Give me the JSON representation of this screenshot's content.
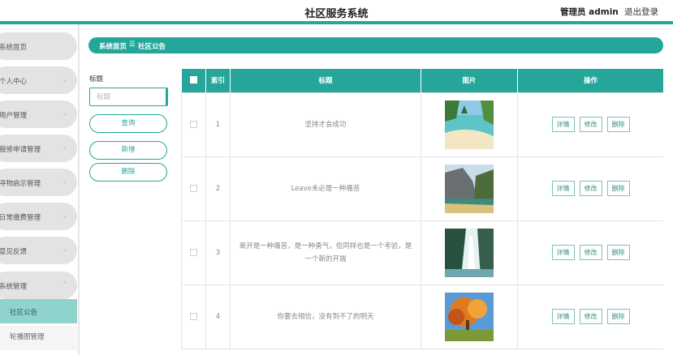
{
  "header": {
    "title": "社区服务系统",
    "admin_label": "管理员 admin",
    "logout_label": "退出登录"
  },
  "sidebar": {
    "items": [
      {
        "label": "系统首页",
        "chevron": ""
      },
      {
        "label": "个人中心",
        "chevron": "⌄"
      },
      {
        "label": "用户管理",
        "chevron": "⌄"
      },
      {
        "label": "报修申请管理",
        "chevron": "⌄"
      },
      {
        "label": "寻物启示管理",
        "chevron": "⌄"
      },
      {
        "label": "日常缴费管理",
        "chevron": "⌄"
      },
      {
        "label": "意见反馈",
        "chevron": "⌄"
      },
      {
        "label": "系统管理",
        "chevron": "⌃"
      }
    ],
    "sub_active": "社区公告",
    "sub_next": "轮播图管理"
  },
  "breadcrumb": {
    "home": "系统首页",
    "separator": "☰",
    "current": "社区公告"
  },
  "search": {
    "label": "标题",
    "placeholder": "标题",
    "value": "",
    "query_button": "查询",
    "add_button": "新增",
    "delete_button": "删除"
  },
  "table": {
    "headers": {
      "index": "索引",
      "title": "标题",
      "image": "图片",
      "actions": "操作"
    },
    "action_labels": {
      "detail": "详情",
      "edit": "修改",
      "delete": "删除"
    },
    "rows": [
      {
        "index": "1",
        "title": "坚持才会成功",
        "image_icon": "beach-photo"
      },
      {
        "index": "2",
        "title": "Leave未必是一种痛苦",
        "image_icon": "cliff-lake-photo"
      },
      {
        "index": "3",
        "title": "离开是一种痛苦，是一种勇气，但同样也是一个考验，是一个新的开端",
        "image_icon": "waterfall-photo"
      },
      {
        "index": "4",
        "title": "你要去相信，没有到不了的明天",
        "image_icon": "autumn-tree-photo"
      }
    ]
  },
  "colors": {
    "accent": "#26a69a",
    "menu_bg": "#e3e3e3",
    "active_sub": "#8fd3cc"
  }
}
